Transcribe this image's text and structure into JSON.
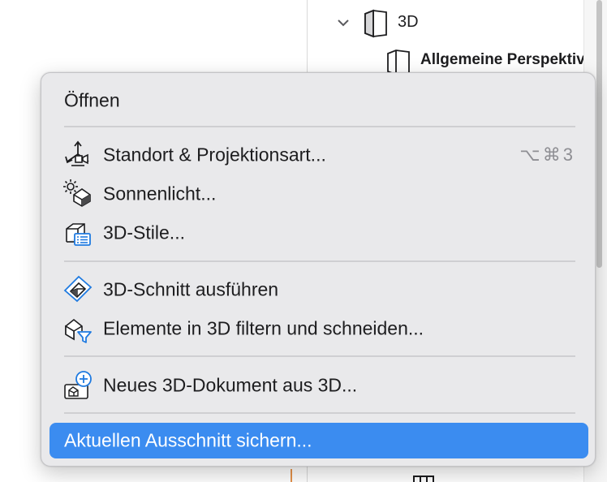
{
  "navigator": {
    "folder_label": "3D",
    "item_label": "Allgemeine Perspektive"
  },
  "menu": {
    "items": [
      {
        "label": "Öffnen",
        "icon": "none"
      },
      {
        "label": "Standort & Projektionsart...",
        "icon": "camera-position-icon",
        "shortcut": "⌥⌘3"
      },
      {
        "label": "Sonnenlicht...",
        "icon": "sun-light-icon"
      },
      {
        "label": "3D-Stile...",
        "icon": "3d-styles-icon"
      },
      {
        "label": "3D-Schnitt ausführen",
        "icon": "3d-cutaway-icon"
      },
      {
        "label": "Elemente in 3D filtern und schneiden...",
        "icon": "filter-cut-icon"
      },
      {
        "label": "Neues 3D-Dokument aus 3D...",
        "icon": "new-3d-document-icon"
      },
      {
        "label": "Aktuellen Ausschnitt sichern...",
        "icon": "none",
        "highlighted": true
      }
    ]
  },
  "colors": {
    "menu_bg": "#e9e9eb",
    "highlight": "#3b8cf0",
    "icon_blue": "#1f7ae0",
    "shortcut_gray": "#8e8e93"
  }
}
